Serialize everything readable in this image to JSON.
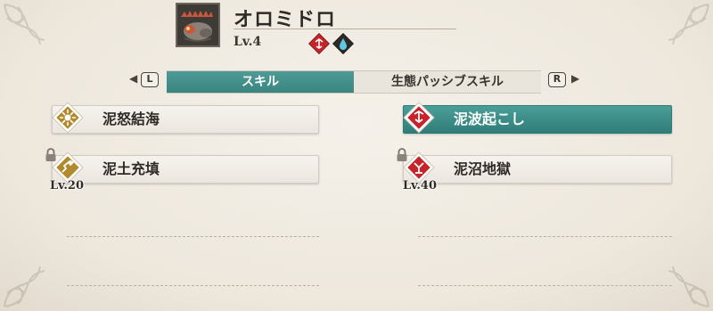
{
  "monster": {
    "name": "オロミドロ",
    "level": "Lv.4",
    "portrait_icon": "monster-portrait-icon",
    "attributes": [
      {
        "icon": "water-element-icon",
        "color": "#c8232b"
      },
      {
        "icon": "water-drop-icon",
        "color": "#2e2a27"
      }
    ]
  },
  "tabs": {
    "left_key": "L",
    "right_key": "R",
    "skill_label": "スキル",
    "passive_label": "生態パッシブスキル",
    "active": "skill"
  },
  "skills": {
    "left": [
      {
        "name": "泥怒結海",
        "icon": "power-up-skill-icon",
        "color": "#b28a2e",
        "locked": false,
        "required_level": ""
      },
      {
        "name": "泥土充填",
        "icon": "power-up-skill-icon",
        "color": "#b28a2e",
        "locked": true,
        "required_level": "Lv.20"
      }
    ],
    "right": [
      {
        "name": "泥波起こし",
        "icon": "attack-skill-icon",
        "color": "#c8232b",
        "locked": false,
        "selected": true,
        "required_level": ""
      },
      {
        "name": "泥沼地獄",
        "icon": "attack-skill-icon",
        "color": "#c8232b",
        "locked": true,
        "required_level": "Lv.40"
      }
    ]
  },
  "colors": {
    "accent_teal": "#3f8f8a",
    "skill_gold": "#b28a2e",
    "skill_red": "#c8232b"
  }
}
